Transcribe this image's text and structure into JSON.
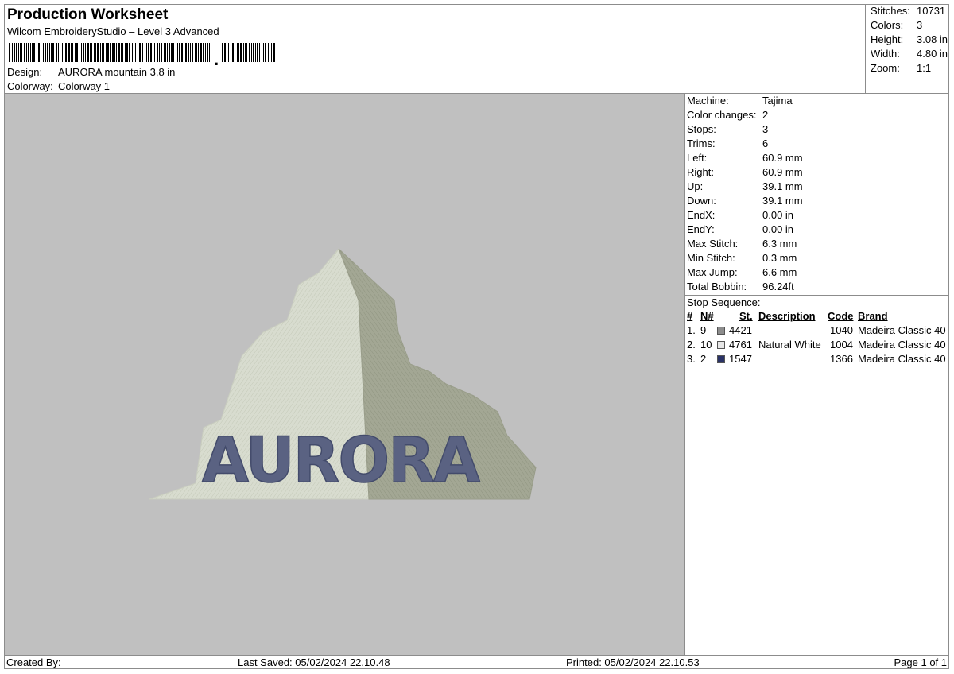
{
  "header": {
    "title": "Production Worksheet",
    "subtitle": "Wilcom EmbroideryStudio – Level 3 Advanced",
    "barcode_suffix": ",",
    "design_label": "Design:",
    "design_value": "AURORA mountain 3,8 in",
    "colorway_label": "Colorway:",
    "colorway_value": "Colorway 1"
  },
  "summary": {
    "stitches_label": "Stitches:",
    "stitches_value": "10731",
    "colors_label": "Colors:",
    "colors_value": "3",
    "height_label": "Height:",
    "height_value": "3.08 in",
    "width_label": "Width:",
    "width_value": "4.80 in",
    "zoom_label": "Zoom:",
    "zoom_value": "1:1"
  },
  "design_preview": {
    "text": "AURORA",
    "colors": {
      "background": "#c0c0c0",
      "light": "#d8dccf",
      "shade": "#a3a794",
      "text": "#5a6282"
    }
  },
  "machine_info": [
    {
      "label": "Machine:",
      "value": "Tajima"
    },
    {
      "label": "Color changes:",
      "value": "2"
    },
    {
      "label": "Stops:",
      "value": "3"
    },
    {
      "label": "Trims:",
      "value": "6"
    },
    {
      "label": "Left:",
      "value": "60.9 mm"
    },
    {
      "label": "Right:",
      "value": "60.9 mm"
    },
    {
      "label": "Up:",
      "value": "39.1 mm"
    },
    {
      "label": "Down:",
      "value": "39.1 mm"
    },
    {
      "label": "EndX:",
      "value": "0.00 in"
    },
    {
      "label": "EndY:",
      "value": "0.00 in"
    },
    {
      "label": "Max Stitch:",
      "value": "6.3 mm"
    },
    {
      "label": "Min Stitch:",
      "value": "0.3 mm"
    },
    {
      "label": "Max Jump:",
      "value": "6.6 mm"
    },
    {
      "label": "Total Bobbin:",
      "value": "96.24ft"
    }
  ],
  "stop_sequence": {
    "title": "Stop Sequence:",
    "headers": {
      "num": "#",
      "n": "N#",
      "st": "St.",
      "description": "Description",
      "code": "Code",
      "brand": "Brand"
    },
    "rows": [
      {
        "num": "1.",
        "n": "9",
        "color": "#8c8c8c",
        "st": "4421",
        "description": "",
        "code": "1040",
        "brand": "Madeira Classic 40"
      },
      {
        "num": "2.",
        "n": "10",
        "color": "#e6e6e6",
        "st": "4761",
        "description": "Natural White",
        "code": "1004",
        "brand": "Madeira Classic 40"
      },
      {
        "num": "3.",
        "n": "2",
        "color": "#2a3266",
        "st": "1547",
        "description": "",
        "code": "1366",
        "brand": "Madeira Classic 40"
      }
    ]
  },
  "footer": {
    "created_by": "Created By:",
    "last_saved": "Last Saved: 05/02/2024 22.10.48",
    "printed": "Printed: 05/02/2024 22.10.53",
    "page": "Page 1 of 1"
  }
}
